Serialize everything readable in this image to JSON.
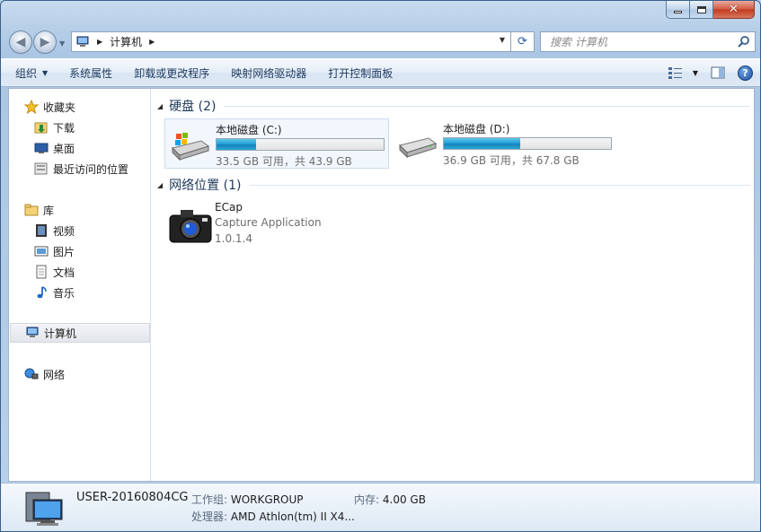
{
  "address": {
    "path": "计算机",
    "search_placeholder": "搜索 计算机"
  },
  "toolbar": {
    "organize": "组织",
    "system_properties": "系统属性",
    "uninstall": "卸载或更改程序",
    "map_drive": "映射网络驱动器",
    "control_panel": "打开控制面板"
  },
  "sidebar": {
    "favorites": "收藏夹",
    "downloads": "下载",
    "desktop": "桌面",
    "recent": "最近访问的位置",
    "library": "库",
    "videos": "视频",
    "pictures": "图片",
    "documents": "文档",
    "music": "音乐",
    "computer": "计算机",
    "network": "网络"
  },
  "groups": {
    "hard_drives": "硬盘 (2)",
    "network_locations": "网络位置 (1)"
  },
  "drives": [
    {
      "name": "本地磁盘 (C:)",
      "free_text": "33.5 GB 可用，共 43.9 GB",
      "used_fraction": 0.237
    },
    {
      "name": "本地磁盘 (D:)",
      "free_text": "36.9 GB 可用，共 67.8 GB",
      "used_fraction": 0.456
    }
  ],
  "network_item": {
    "name": "ECap",
    "description": "Capture Application",
    "version": "1.0.1.4"
  },
  "details": {
    "computer_name": "USER-20160804CG",
    "workgroup_label": "工作组:",
    "workgroup_value": "WORKGROUP",
    "memory_label": "内存:",
    "memory_value": "4.00 GB",
    "cpu_label": "处理器:",
    "cpu_value": "AMD Athlon(tm) II X4..."
  }
}
